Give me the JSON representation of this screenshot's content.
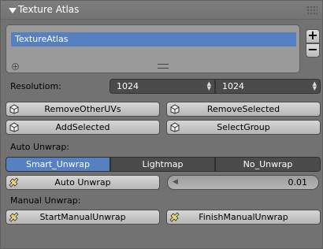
{
  "panel": {
    "title": "Texture Atlas"
  },
  "list": {
    "items": [
      "TextureAtlas"
    ],
    "add_label": "+",
    "remove_label": "−"
  },
  "resolution": {
    "label": "Resolutiom:",
    "width": "1024",
    "height": "1024"
  },
  "buttons": {
    "remove_other_uvs": "RemoveOtherUVs",
    "remove_selected": "RemoveSelected",
    "add_selected": "AddSelected",
    "select_group": "SelectGroup"
  },
  "auto_unwrap": {
    "section_label": "Auto Unwrap:",
    "modes": [
      "Smart_Unwrap",
      "Lightmap",
      "No_Unwrap"
    ],
    "active_mode": "Smart_Unwrap",
    "button_label": "Auto Unwrap",
    "value": "0.01"
  },
  "manual_unwrap": {
    "section_label": "Manual Unwrap:",
    "start_label": "StartManualUnwrap",
    "finish_label": "FinishManualUnwrap"
  },
  "colors": {
    "accent": "#5680c2",
    "panel_bg": "#727272",
    "field_bg": "#4b4b4b"
  }
}
